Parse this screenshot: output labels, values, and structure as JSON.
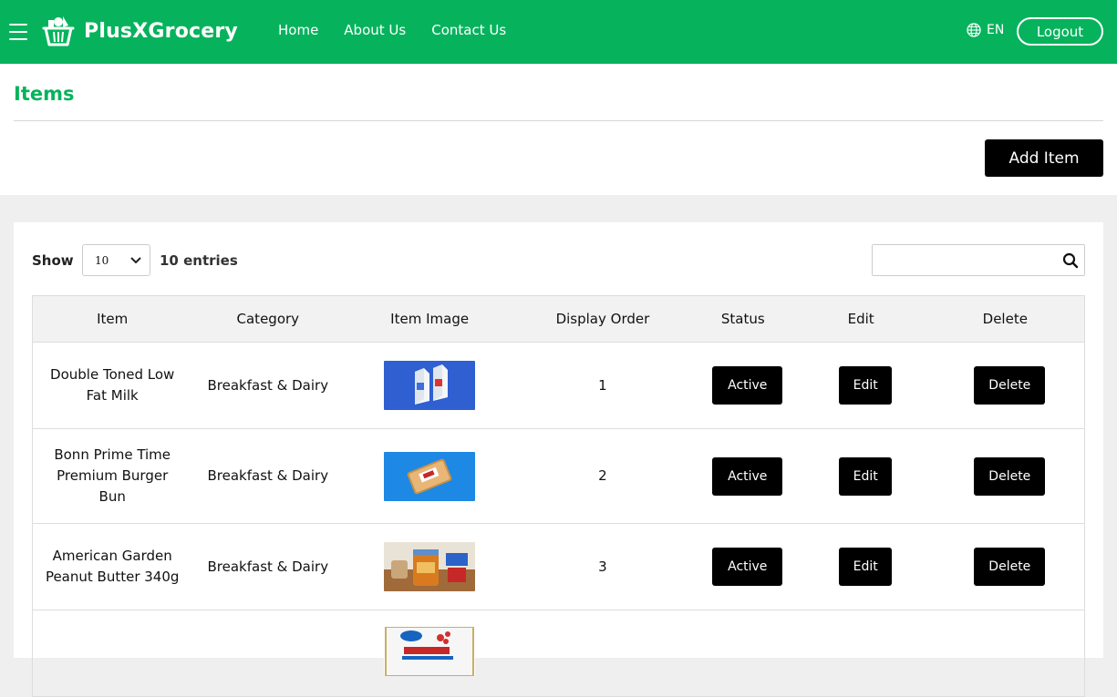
{
  "brand": {
    "name": "PlusXGrocery",
    "color": "#06b35c"
  },
  "nav": {
    "items": [
      "Home",
      "About Us",
      "Contact Us"
    ],
    "language": "EN",
    "logout_label": "Logout"
  },
  "page": {
    "title": "Items",
    "add_label": "Add Item"
  },
  "list_controls": {
    "show_label": "Show",
    "page_size": "10",
    "entries_label": "10 entries",
    "search_placeholder": ""
  },
  "table": {
    "headers": [
      "Item",
      "Category",
      "Item Image",
      "Display Order",
      "Status",
      "Edit",
      "Delete"
    ],
    "rows": [
      {
        "item": "Double Toned Low Fat Milk",
        "category": "Breakfast & Dairy",
        "order": "1",
        "status": "Active",
        "edit": "Edit",
        "delete": "Delete"
      },
      {
        "item": "Bonn Prime Time Premium Burger Bun",
        "category": "Breakfast & Dairy",
        "order": "2",
        "status": "Active",
        "edit": "Edit",
        "delete": "Delete"
      },
      {
        "item": "American Garden Peanut Butter 340g",
        "category": "Breakfast & Dairy",
        "order": "3",
        "status": "Active",
        "edit": "Edit",
        "delete": "Delete"
      },
      {
        "item": "",
        "category": "",
        "order": "",
        "status": "",
        "edit": "",
        "delete": ""
      }
    ]
  },
  "icons": {
    "menu": "hamburger-icon",
    "language": "globe-icon",
    "search": "search-icon",
    "dropdown": "chevron-down-icon"
  }
}
